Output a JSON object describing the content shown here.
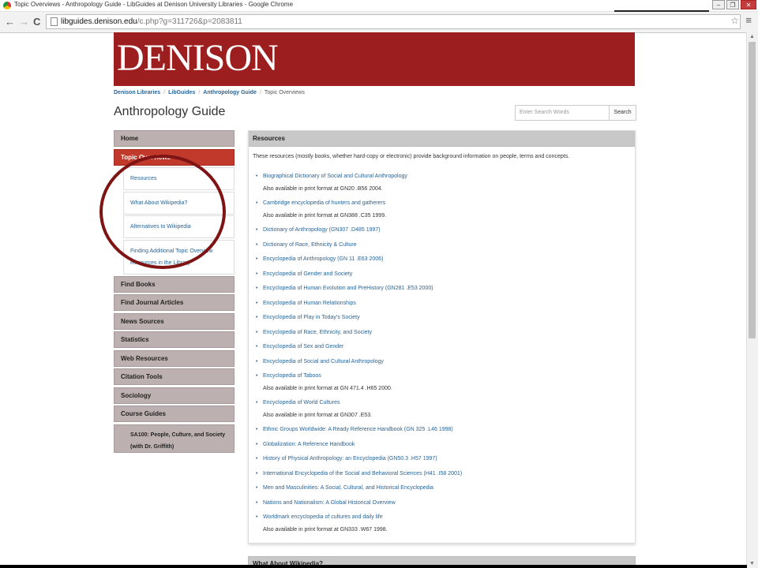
{
  "browser": {
    "title": "Topic Overviews - Anthropology Guide - LibGuides at Denison University Libraries - Google Chrome",
    "url_host": "libguides.denison.edu",
    "url_path": "/c.php?g=311726&p=2083811",
    "win_minimize": "–",
    "win_restore": "❐",
    "win_close": "✕",
    "back_icon": "←",
    "forward_icon": "→",
    "reload_icon": "C",
    "star_icon": "☆",
    "menu_icon": "≡"
  },
  "site": {
    "logo": "DENISON",
    "brand_color": "#9c1e1e"
  },
  "breadcrumb": [
    "Denison Libraries",
    "LibGuides",
    "Anthropology Guide",
    "Topic Overviews"
  ],
  "page_title": "Anthropology Guide",
  "search": {
    "placeholder": "Enter Search Words",
    "button": "Search"
  },
  "nav": {
    "home": "Home",
    "topic_overviews": "Topic Overviews",
    "sub": [
      "Resources",
      "What About Wikipedia?",
      "Alternatives to Wikipedia",
      "Finding Additional Topic Overview Resources in the Library"
    ],
    "after": [
      "Find Books",
      "Find Journal Articles",
      "News Sources",
      "Statistics",
      "Web Resources",
      "Citation Tools",
      "Sociology",
      "Course Guides"
    ],
    "course": "SA100: People, Culture, and Society (with Dr. Griffith)"
  },
  "panel": {
    "heading": "Resources",
    "intro": "These resources (mostly books, whether hard-copy or electronic) provide background information on people, terms and concepts.",
    "items": [
      {
        "link": "Biographical Dictionary of Social and Cultural Anthropology",
        "note": "Also available in print format at GN20 .B56 2004."
      },
      {
        "link": "Cambridge encyclopedia of hunters and gatherers",
        "note": "Also available in print format at GN388 .C35 1999."
      },
      {
        "link": "Dictionary of Anthropology (GN307 .D485 1997)"
      },
      {
        "link": "Dictionary of Race, Ethnicity & Culture"
      },
      {
        "link": "Encyclopedia of Anthropology (GN 11 .E63 2006)"
      },
      {
        "link": "Encyclopedia of Gender and Society"
      },
      {
        "link": "Encyclopedia of Human Evolution and PreHistory (GN281 .E53 2000)"
      },
      {
        "link": "Encyclopedia of Human Relationships"
      },
      {
        "link": "Encyclopedia of Play in Today's Society"
      },
      {
        "link": "Encyclopedia of Race, Ethnicity, and Society"
      },
      {
        "link": "Encyclopedia of Sex and Gender"
      },
      {
        "link": "Encyclopedia of Social and Cultural Anthropology"
      },
      {
        "link": "Encyclopedia of Taboos",
        "note": "Also available in print format at GN 471.4 .H65 2000."
      },
      {
        "link": "Encyclopedia of World Cultures",
        "note": "Also available in print format at GN307 .E53."
      },
      {
        "link": "Ethnic Groups Worldwide: A Ready Reference Handbook (GN 325 .L46 1998)"
      },
      {
        "link": "Globalization: A Reference Handbook"
      },
      {
        "link": "History of Physical Anthropology: an Encyclopedia (GN50.3 .H57 1997)"
      },
      {
        "link": "International Encyclopedia of the Social and Behavioral Sciences (H41 .I58 2001)"
      },
      {
        "link": "Men and Masculinities: A Social, Cultural, and Historical Encyclopedia"
      },
      {
        "link": "Nations and Nationalism: A Global Historical Overview"
      },
      {
        "link": "Worldmark encyclopedia of cultures and daily life",
        "note": "Also available in print format at GN333 .W67 1998."
      }
    ]
  },
  "next_panel_heading": "What About Wikipedia?"
}
